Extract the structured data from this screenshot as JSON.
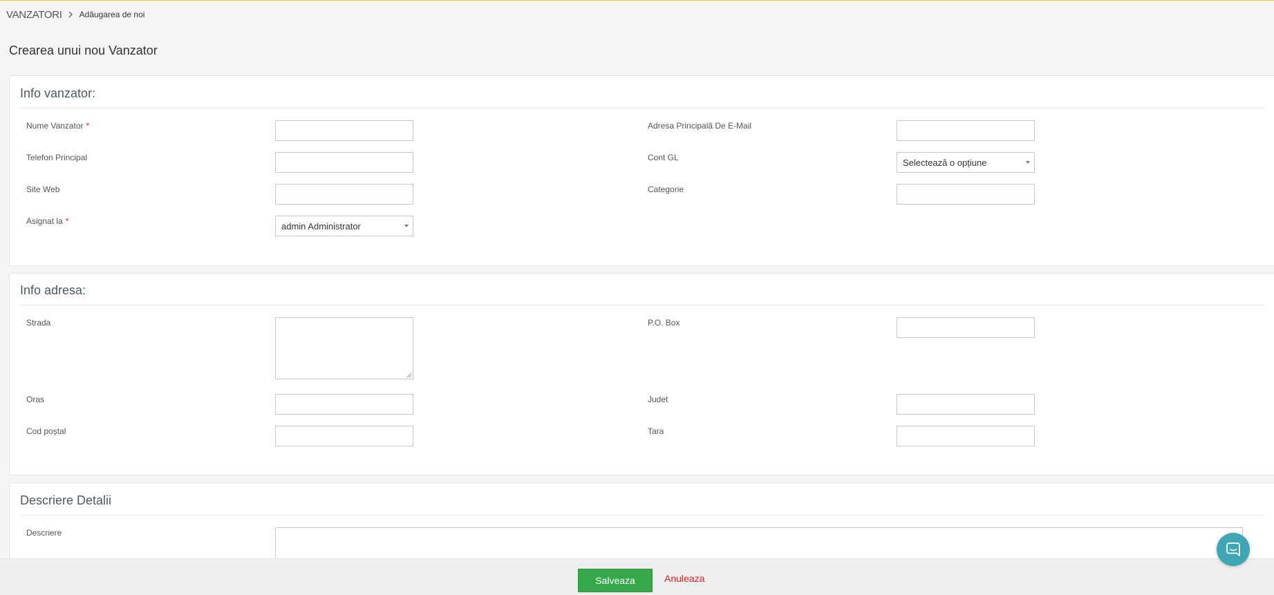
{
  "breadcrumb": {
    "module": "VANZATORI",
    "current": "Adăugarea de noi"
  },
  "page_title": "Crearea unui nou Vanzator",
  "sections": {
    "vendor_info": {
      "title": "Info vanzator:",
      "fields": {
        "name": {
          "label": "Nume Vanzator",
          "value": "",
          "required_mark": "*"
        },
        "email": {
          "label": "Adresa Principală De E-Mail",
          "value": ""
        },
        "phone": {
          "label": "Telefon Principal",
          "value": ""
        },
        "gl_account": {
          "label": "Cont GL",
          "value": "Selectează o opțiune"
        },
        "website": {
          "label": "Site Web",
          "value": ""
        },
        "category": {
          "label": "Categorie",
          "value": ""
        },
        "assigned_to": {
          "label": "Asignat la",
          "value": "admin Administrator",
          "required_mark": "*"
        }
      }
    },
    "address_info": {
      "title": "Info adresa:",
      "fields": {
        "street": {
          "label": "Strada",
          "value": ""
        },
        "po_box": {
          "label": "P.O. Box",
          "value": ""
        },
        "city": {
          "label": "Oras",
          "value": ""
        },
        "county": {
          "label": "Judet",
          "value": ""
        },
        "postal_code": {
          "label": "Cod poștal",
          "value": ""
        },
        "country": {
          "label": "Tara",
          "value": ""
        }
      }
    },
    "description_details": {
      "title": "Descriere Detalii",
      "fields": {
        "description": {
          "label": "Descriere",
          "value": ""
        }
      }
    }
  },
  "footer": {
    "save_label": "Salveaza",
    "cancel_label": "Anuleaza"
  },
  "colors": {
    "accent_line": "#e6c34a",
    "save_button": "#35a84a",
    "cancel_link": "#e02020",
    "required_mark": "#e02020",
    "chat_button": "#3fa6b5"
  },
  "icons": {
    "breadcrumb_separator": "chevron-right-icon",
    "chat": "chat-bubble-icon"
  }
}
